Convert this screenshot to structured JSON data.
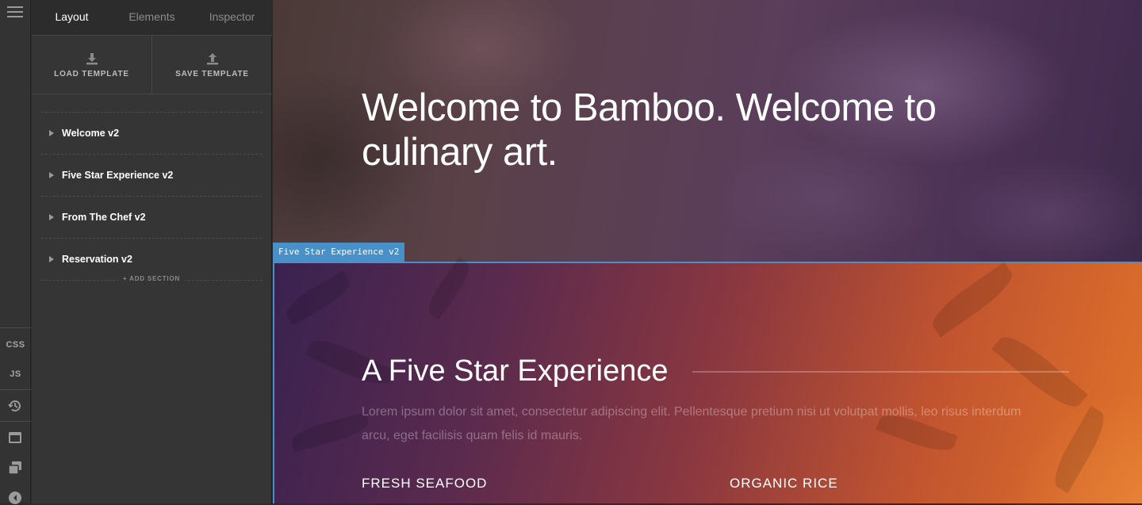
{
  "rail": {
    "css_label": "CSS",
    "js_label": "JS"
  },
  "panel": {
    "tabs": [
      {
        "label": "Layout"
      },
      {
        "label": "Elements"
      },
      {
        "label": "Inspector"
      }
    ],
    "templates": {
      "load_label": "LOAD TEMPLATE",
      "save_label": "SAVE TEMPLATE"
    },
    "sections": [
      {
        "label": "Welcome v2"
      },
      {
        "label": "Five Star Experience v2"
      },
      {
        "label": "From The Chef v2"
      },
      {
        "label": "Reservation v2"
      }
    ],
    "add_section_label": "+ ADD SECTION"
  },
  "preview": {
    "hero_title": "Welcome to Bamboo. Welcome to culinary art.",
    "selected_label": "Five Star Experience v2",
    "five_star": {
      "title": "A Five Star Experience",
      "paragraph": "Lorem ipsum dolor sit amet, consectetur adipiscing elit. Pellentesque pretium nisi ut volutpat mollis, leo risus interdum arcu, eget facilisis quam felis id mauris.",
      "col1": "FRESH SEAFOOD",
      "col2": "ORGANIC RICE"
    }
  },
  "colors": {
    "selection": "#4a90c8",
    "panel_bg": "#353535"
  }
}
